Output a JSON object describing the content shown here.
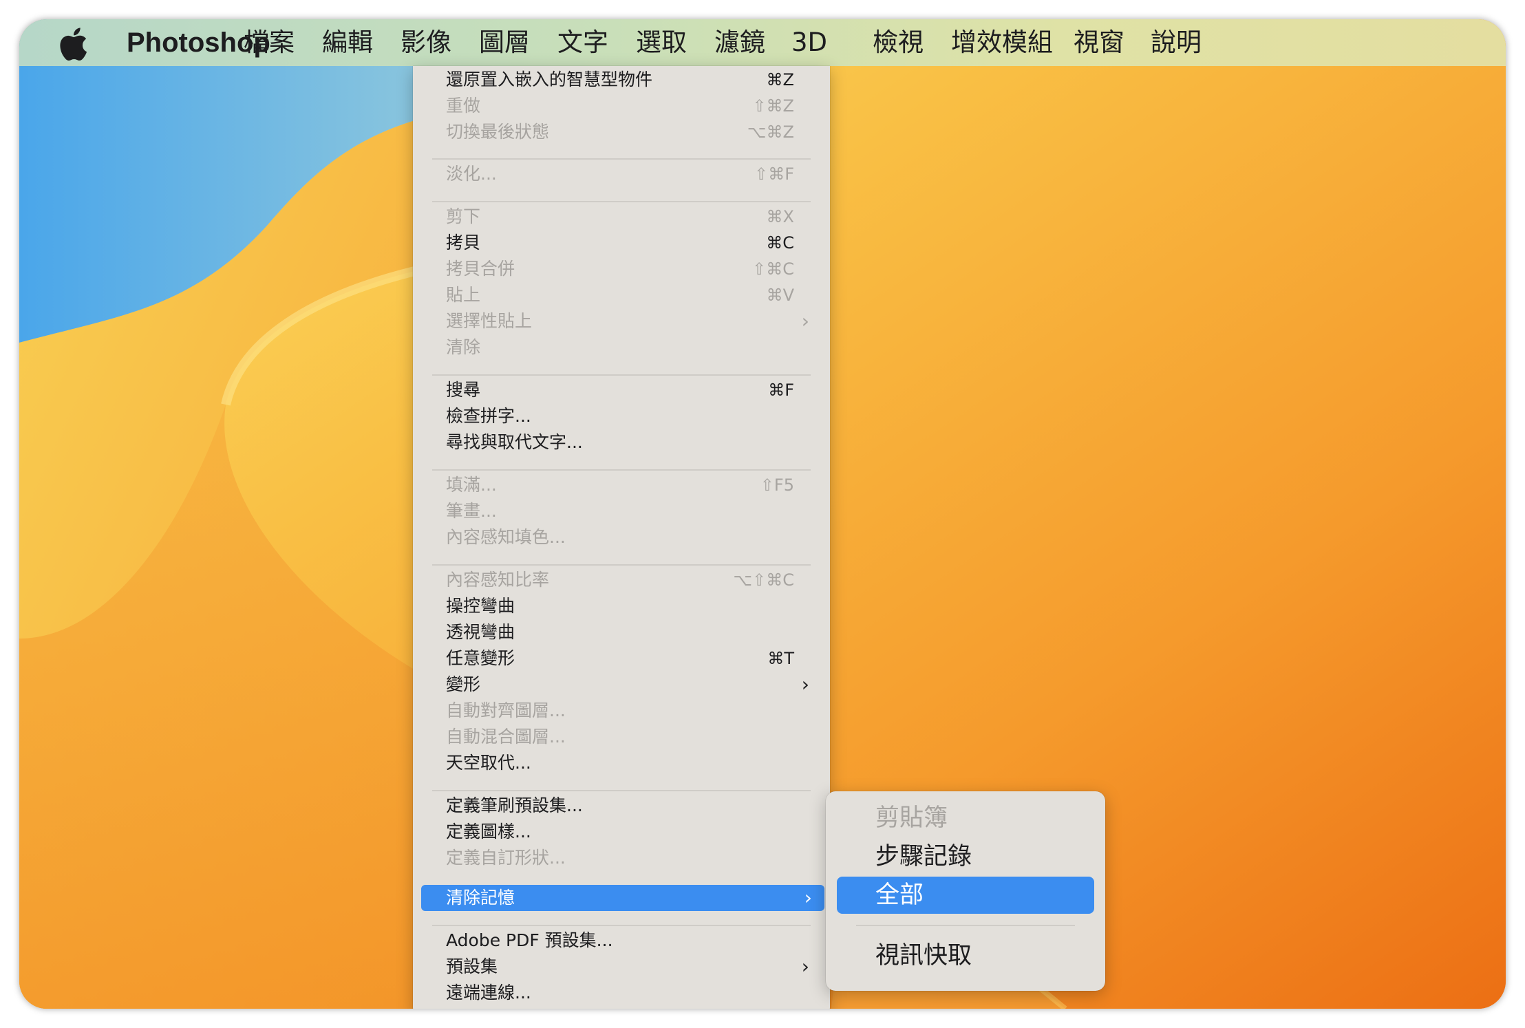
{
  "menubar": {
    "apple_icon": "apple-logo-icon",
    "app_name": "Photoshop",
    "items": [
      "檔案",
      "編輯",
      "影像",
      "圖層",
      "文字",
      "選取",
      "濾鏡",
      "3D",
      "檢視",
      "增效模組",
      "視窗",
      "說明"
    ]
  },
  "edit_menu": {
    "items": [
      {
        "label": "還原置入嵌入的智慧型物件",
        "shortcut": "⌘Z",
        "enabled": true
      },
      {
        "label": "重做",
        "shortcut": "⇧⌘Z",
        "enabled": false
      },
      {
        "label": "切換最後狀態",
        "shortcut": "⌥⌘Z",
        "enabled": false
      },
      {
        "label": "淡化...",
        "shortcut": "⇧⌘F",
        "enabled": false
      },
      {
        "label": "剪下",
        "shortcut": "⌘X",
        "enabled": false
      },
      {
        "label": "拷貝",
        "shortcut": "⌘C",
        "enabled": true
      },
      {
        "label": "拷貝合併",
        "shortcut": "⇧⌘C",
        "enabled": false
      },
      {
        "label": "貼上",
        "shortcut": "⌘V",
        "enabled": false
      },
      {
        "label": "選擇性貼上",
        "shortcut": "",
        "enabled": false,
        "submenu": true
      },
      {
        "label": "清除",
        "shortcut": "",
        "enabled": false
      },
      {
        "label": "搜尋",
        "shortcut": "⌘F",
        "enabled": true
      },
      {
        "label": "檢查拼字...",
        "shortcut": "",
        "enabled": true
      },
      {
        "label": "尋找與取代文字...",
        "shortcut": "",
        "enabled": true
      },
      {
        "label": "填滿...",
        "shortcut": "⇧F5",
        "enabled": false
      },
      {
        "label": "筆畫...",
        "shortcut": "",
        "enabled": false
      },
      {
        "label": "內容感知填色...",
        "shortcut": "",
        "enabled": false
      },
      {
        "label": "內容感知比率",
        "shortcut": "⌥⇧⌘C",
        "enabled": false
      },
      {
        "label": "操控彎曲",
        "shortcut": "",
        "enabled": true
      },
      {
        "label": "透視彎曲",
        "shortcut": "",
        "enabled": true
      },
      {
        "label": "任意變形",
        "shortcut": "⌘T",
        "enabled": true
      },
      {
        "label": "變形",
        "shortcut": "",
        "enabled": true,
        "submenu": true
      },
      {
        "label": "自動對齊圖層...",
        "shortcut": "",
        "enabled": false
      },
      {
        "label": "自動混合圖層...",
        "shortcut": "",
        "enabled": false
      },
      {
        "label": "天空取代...",
        "shortcut": "",
        "enabled": true
      },
      {
        "label": "定義筆刷預設集...",
        "shortcut": "",
        "enabled": true
      },
      {
        "label": "定義圖樣...",
        "shortcut": "",
        "enabled": true
      },
      {
        "label": "定義自訂形狀...",
        "shortcut": "",
        "enabled": false
      },
      {
        "label": "清除記憶",
        "shortcut": "",
        "enabled": true,
        "submenu": true,
        "highlighted": true
      },
      {
        "label": "Adobe PDF 預設集...",
        "shortcut": "",
        "enabled": true
      },
      {
        "label": "預設集",
        "shortcut": "",
        "enabled": true,
        "submenu": true
      },
      {
        "label": "遠端連線...",
        "shortcut": "",
        "enabled": true
      }
    ]
  },
  "purge_submenu": {
    "items": [
      {
        "label": "剪貼簿",
        "enabled": false
      },
      {
        "label": "步驟記錄",
        "enabled": true
      },
      {
        "label": "全部",
        "enabled": true,
        "highlighted": true
      },
      {
        "label": "視訊快取",
        "enabled": true
      }
    ]
  },
  "chevron": "›",
  "colors": {
    "highlight": "#3b8df0",
    "menu_bg": "#e3e0db",
    "disabled_text": "#a7a4a0"
  }
}
